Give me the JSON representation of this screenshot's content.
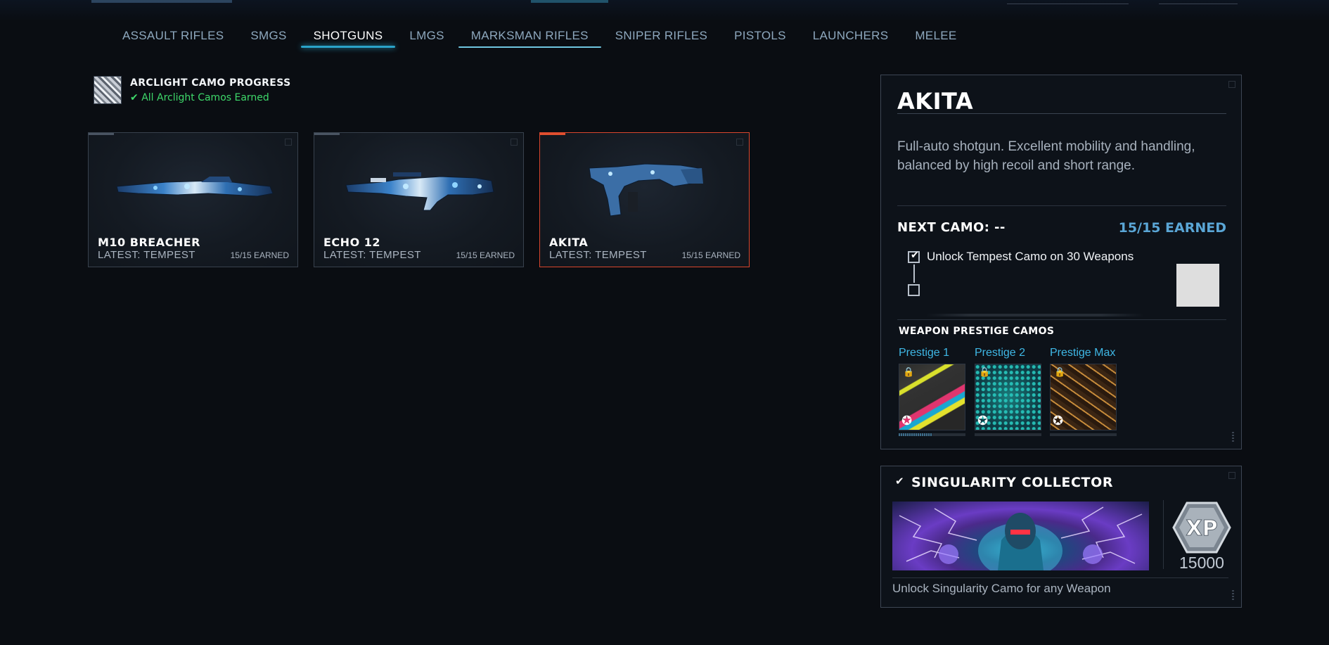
{
  "nav": {
    "tabs": [
      {
        "label": "ASSAULT RIFLES"
      },
      {
        "label": "SMGS"
      },
      {
        "label": "SHOTGUNS"
      },
      {
        "label": "LMGS"
      },
      {
        "label": "MARKSMAN RIFLES"
      },
      {
        "label": "SNIPER RIFLES"
      },
      {
        "label": "PISTOLS"
      },
      {
        "label": "LAUNCHERS"
      },
      {
        "label": "MELEE"
      }
    ],
    "active": "SHOTGUNS"
  },
  "arclight": {
    "title": "ARCLIGHT CAMO PROGRESS",
    "check": "✔",
    "status": "All Arclight Camos Earned"
  },
  "weapons": [
    {
      "name": "M10 BREACHER",
      "latest": "LATEST: TEMPEST",
      "earned": "15/15 EARNED"
    },
    {
      "name": "ECHO 12",
      "latest": "LATEST: TEMPEST",
      "earned": "15/15 EARNED"
    },
    {
      "name": "AKITA",
      "latest": "LATEST: TEMPEST",
      "earned": "15/15 EARNED"
    }
  ],
  "detail": {
    "title": "AKITA",
    "description": "Full-auto shotgun. Excellent mobility and handling, balanced by high recoil and short range.",
    "next_camo": "NEXT CAMO: --",
    "earned": "15/15 EARNED",
    "challenge": "Unlock Tempest Camo on 30 Weapons",
    "check": "✔",
    "prestige_heading": "WEAPON PRESTIGE CAMOS",
    "prestige": [
      {
        "label": "Prestige 1",
        "progress": 0.5
      },
      {
        "label": "Prestige 2",
        "progress": 0
      },
      {
        "label": "Prestige Max",
        "progress": 0
      }
    ]
  },
  "singularity": {
    "check": "✔",
    "title": "SINGULARITY COLLECTOR",
    "xp_label": "XP",
    "xp_amount": "15000",
    "description": "Unlock Singularity Camo for any Weapon"
  },
  "colors": {
    "accent": "#2aa3c9",
    "selected_border": "#d8462d",
    "earned_green": "#3ed86a",
    "earned_blue": "#5aa6d6",
    "prestige_label": "#3fb8e6"
  },
  "icons": {
    "lock": "lock-icon",
    "emblem": "prestige-emblem-icon",
    "check": "check-icon"
  }
}
